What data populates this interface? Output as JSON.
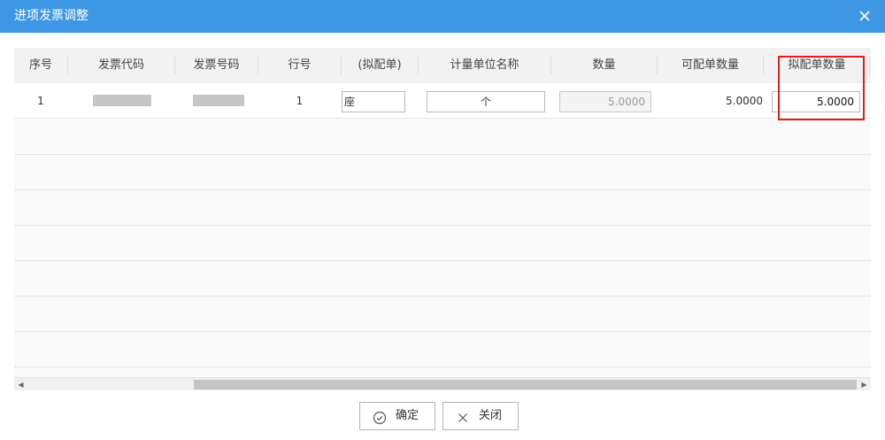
{
  "dialog": {
    "title": "进项发票调整"
  },
  "table": {
    "columns": [
      "序号",
      "发票代码",
      "发票号码",
      "行号",
      "(拟配单)",
      "计量单位名称",
      "数量",
      "可配单数量",
      "拟配单数量"
    ],
    "rows": [
      {
        "index": "1",
        "invoice_code": "",
        "invoice_number": "",
        "line_no": "1",
        "planned_name": "座",
        "unit_name": "个",
        "quantity": "5.0000",
        "available_qty": "5.0000",
        "planned_qty": "5.0000"
      }
    ]
  },
  "buttons": {
    "confirm": "确定",
    "close": "关闭"
  },
  "colors": {
    "titlebar": "#3d97e4",
    "highlight": "#e01e1e"
  },
  "icons": {
    "close": "close-icon",
    "confirm": "check-circle-icon",
    "cancel": "x-icon"
  }
}
